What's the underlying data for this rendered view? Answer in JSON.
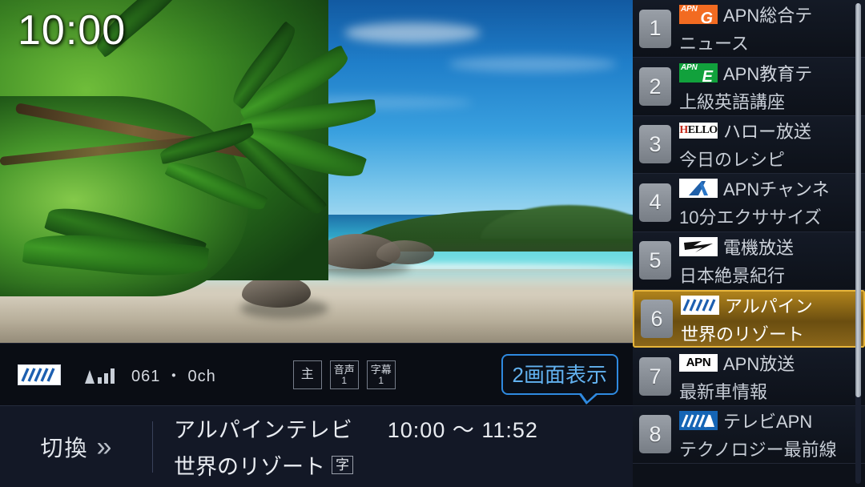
{
  "clock": "10:00",
  "status": {
    "channel_logo": "alpine-stripes-logo",
    "signal_icon": "signal-strength-icon",
    "channel_number": "061 ・ 0ch",
    "badges": [
      {
        "name": "main-audio-badge",
        "line1": "主",
        "line2": ""
      },
      {
        "name": "audio-track-badge",
        "line1": "音声",
        "line2": "1"
      },
      {
        "name": "subtitle-track-badge",
        "line1": "字幕",
        "line2": "1"
      }
    ],
    "two_screen_button": "2画面表示"
  },
  "program": {
    "switch_label": "切換",
    "switch_icon": "double-chevron-right-icon",
    "station": "アルパインテレビ",
    "time_range": "10:00 ～ 11:52",
    "title": "世界のリゾート",
    "subtitle_badge": "字"
  },
  "channels": [
    {
      "number": "1",
      "logo": "apn-g-logo",
      "logo_kind": "apng",
      "logo_sup": "APN",
      "logo_main": "G",
      "name": "APN総合テ",
      "program": "ニュース",
      "selected": false
    },
    {
      "number": "2",
      "logo": "apn-e-logo",
      "logo_kind": "apne",
      "logo_sup": "APN",
      "logo_main": "E",
      "name": "APN教育テ",
      "program": "上級英語講座",
      "selected": false
    },
    {
      "number": "3",
      "logo": "hello-logo",
      "logo_kind": "hello",
      "logo_sup": "H",
      "logo_main": "ELLO",
      "name": "ハロー放送",
      "program": "今日のレシピ",
      "selected": false
    },
    {
      "number": "4",
      "logo": "apn-channel-a-logo",
      "logo_kind": "a-mark",
      "logo_sup": "",
      "logo_main": "",
      "name": "APNチャンネ",
      "program": "10分エクササイズ",
      "selected": false
    },
    {
      "number": "5",
      "logo": "denki-bolt-logo",
      "logo_kind": "bolt",
      "logo_sup": "",
      "logo_main": "",
      "name": "電機放送",
      "program": "日本絶景紀行",
      "selected": false
    },
    {
      "number": "6",
      "logo": "alpine-stripes-logo",
      "logo_kind": "stripes-white",
      "logo_sup": "",
      "logo_main": "",
      "name": "アルパイン",
      "program": "世界のリゾート",
      "selected": true
    },
    {
      "number": "7",
      "logo": "apn-text-logo",
      "logo_kind": "apn-text",
      "logo_sup": "",
      "logo_main": "APN",
      "name": "APN放送",
      "program": "最新車情報",
      "selected": false
    },
    {
      "number": "8",
      "logo": "tv-apn-logo",
      "logo_kind": "stripes-blue",
      "logo_sup": "",
      "logo_main": "",
      "name": "テレビAPN",
      "program": "テクノロジー最前線",
      "selected": false
    }
  ],
  "colors": {
    "accent_blue": "#2f8ae0",
    "selected_gold": "#e7b53a",
    "panel_bg": "#0d1119",
    "text_primary": "#cfd4dc"
  }
}
